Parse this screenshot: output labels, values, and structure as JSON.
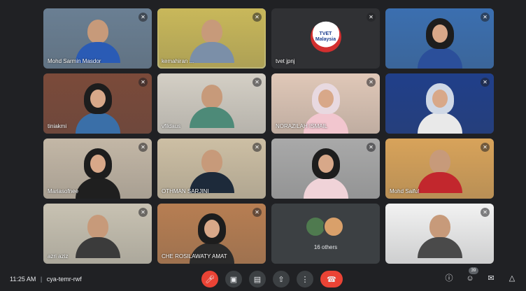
{
  "participants": [
    {
      "name": "Mohd Sarmin Masdor",
      "bg": "#6a7f93",
      "shirt": "#2a5bb5"
    },
    {
      "name": "kemahiran ...",
      "bg": "#c9b85a",
      "shirt": "#7b8fa8",
      "active": true
    },
    {
      "name": "tvet jpnj",
      "logo": "TVET Malaysia"
    },
    {
      "name": "",
      "bg": "#3b6fb0",
      "shirt": "#2b4f9a"
    },
    {
      "name": "tiniakmi",
      "bg": "#7b4a3a",
      "shirt": "#3a6fa8"
    },
    {
      "name": "vfildaus",
      "bg": "#d4cfc5",
      "shirt": "#4d8a78"
    },
    {
      "name": "NORAZILAH ISMAIL",
      "bg": "#e0c8b8",
      "shirt": "#f2c6cf"
    },
    {
      "name": "",
      "bg": "#203f8a",
      "shirt": "#e9e9e9"
    },
    {
      "name": "Mariasofnee",
      "bg": "#c3b7a6",
      "shirt": "#1f1f1f"
    },
    {
      "name": "OTHMAN SARJINI",
      "bg": "#cdbfa4",
      "shirt": "#1d2a3a"
    },
    {
      "name": "",
      "bg": "#a9a9a9",
      "shirt": "#f0d3d8"
    },
    {
      "name": "Mohd Saiful",
      "bg": "#d8a35a",
      "shirt": "#c2272d"
    },
    {
      "name": "azri aziz",
      "bg": "#c8c2b2",
      "shirt": "#3b3b3b"
    },
    {
      "name": "CHE ROSILAWATY AMAT",
      "bg": "#b77e52",
      "shirt": "#2b2b2b"
    },
    {
      "others": "16 others"
    },
    {
      "name": "",
      "bg": "#f2f2f2",
      "shirt": "#4a4a4a"
    }
  ],
  "bottom": {
    "time": "11:25 AM",
    "separator": "|",
    "meeting_code": "cya-temr-rwf",
    "people_count": "39"
  }
}
